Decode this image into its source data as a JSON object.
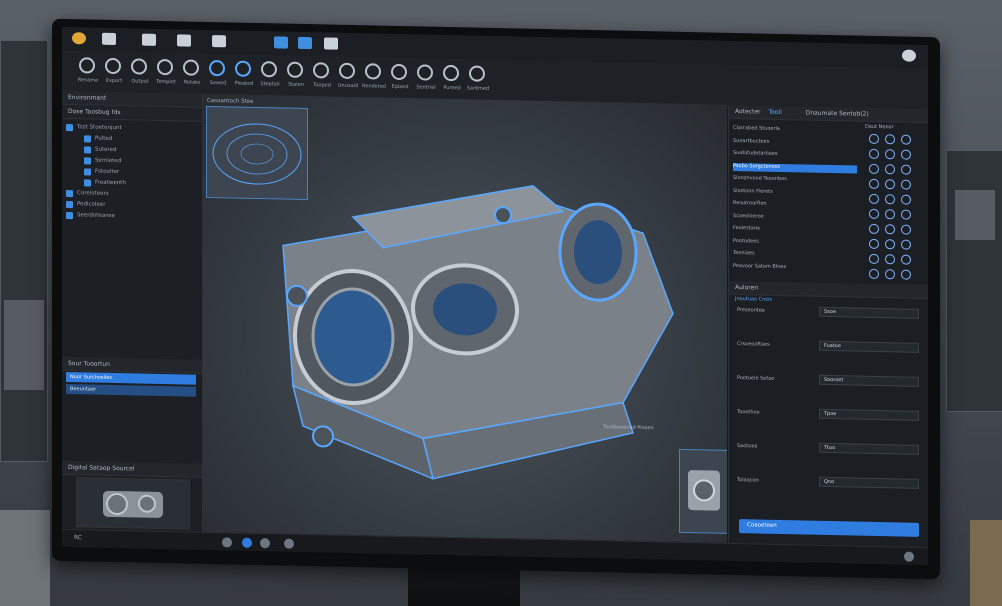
{
  "colors": {
    "accent": "#2f7de1",
    "accent_light": "#5aa7ff",
    "panel": "#1c1f23",
    "part_metal": "#9aa1a9"
  },
  "topbar": {
    "icons": [
      "app-icon",
      "file-icon",
      "edit-icon",
      "view-icon",
      "insert-icon",
      "tools-icon",
      "window-icon",
      "help-icon"
    ]
  },
  "ribbon": {
    "buttons": [
      {
        "icon": "new-icon",
        "label": "Rename"
      },
      {
        "icon": "open-icon",
        "label": "Export"
      },
      {
        "icon": "save-icon",
        "label": "Output"
      },
      {
        "icon": "sketch-icon",
        "label": "Templet"
      },
      {
        "icon": "extrude-icon",
        "label": "Rotate"
      },
      {
        "icon": "revolve-icon",
        "label": "Sewed"
      },
      {
        "icon": "fillet-icon",
        "label": "Pleated"
      },
      {
        "icon": "chamfer-icon",
        "label": "Steptail"
      },
      {
        "icon": "shell-icon",
        "label": "Stalen"
      },
      {
        "icon": "mirror-icon",
        "label": "Tooped"
      },
      {
        "icon": "measure-icon",
        "label": "Unusaid"
      },
      {
        "icon": "section-icon",
        "label": "Rendered"
      },
      {
        "icon": "render-icon",
        "label": "Eplaed"
      },
      {
        "icon": "settings-icon",
        "label": "Sentrial"
      },
      {
        "icon": "export-icon",
        "label": "Pureed"
      },
      {
        "icon": "layers-icon",
        "label": "Santmed"
      }
    ]
  },
  "left_panel": {
    "title": "Environment",
    "tree_header": "Dose Toosbug fds",
    "tree": [
      "Tost Stoetenjunt",
      "Pulted",
      "Sutered",
      "Semleted",
      "Fstoolter",
      "Freatwenth",
      "Coreloteers",
      "Pedicoleer",
      "Seerdoteanse"
    ],
    "lower_header": "Sour Tuoortun",
    "lower_items": [
      "Nuor Surchosiles",
      "Beeuntaer"
    ],
    "preview_title": "Digital Sataop Sourcel"
  },
  "viewport": {
    "label": "Casoantoch Stee",
    "inset_caption": "Tooltlowened Plosen"
  },
  "right_panel": {
    "tabs": [
      "Aotecter",
      "Tooll"
    ],
    "header": "Dnaumate Sentob(2)",
    "small_header": "Daut Neoor",
    "items": [
      "Clarrabed Stuoerla",
      "Sueartbuctees",
      "Suebitudetartiaes",
      "Psobo Sorgctonoss",
      "Slonshvood Teoonbes",
      "Slostonn Fierets",
      "Resutroorfien",
      "Scoeoloeroe",
      "Feolestane",
      "Pootodees",
      "Teeniaes",
      "Peavoor Satom Blnes"
    ],
    "section2": "Auloren",
    "section2_sub": "Jnoutuao Cnsis",
    "fields": [
      {
        "label": "Preseontee",
        "value": "Ssoe"
      },
      {
        "label": "Crsoeooftaes",
        "value": "Fuatoe"
      },
      {
        "label": "Pootoele Setoo",
        "value": "Sooroet"
      },
      {
        "label": "Tooothoe",
        "value": "Tpoe"
      },
      {
        "label": "Saotoea",
        "value": "Ttoo"
      },
      {
        "label": "Tolaacon",
        "value": "Qno"
      }
    ],
    "bottom_button": "Coaoeteen"
  },
  "statusbar": {
    "left_text": "RC",
    "icons": [
      "rotate-icon",
      "pan-icon",
      "zoom-icon",
      "fit-icon",
      "view-cube-icon"
    ]
  }
}
